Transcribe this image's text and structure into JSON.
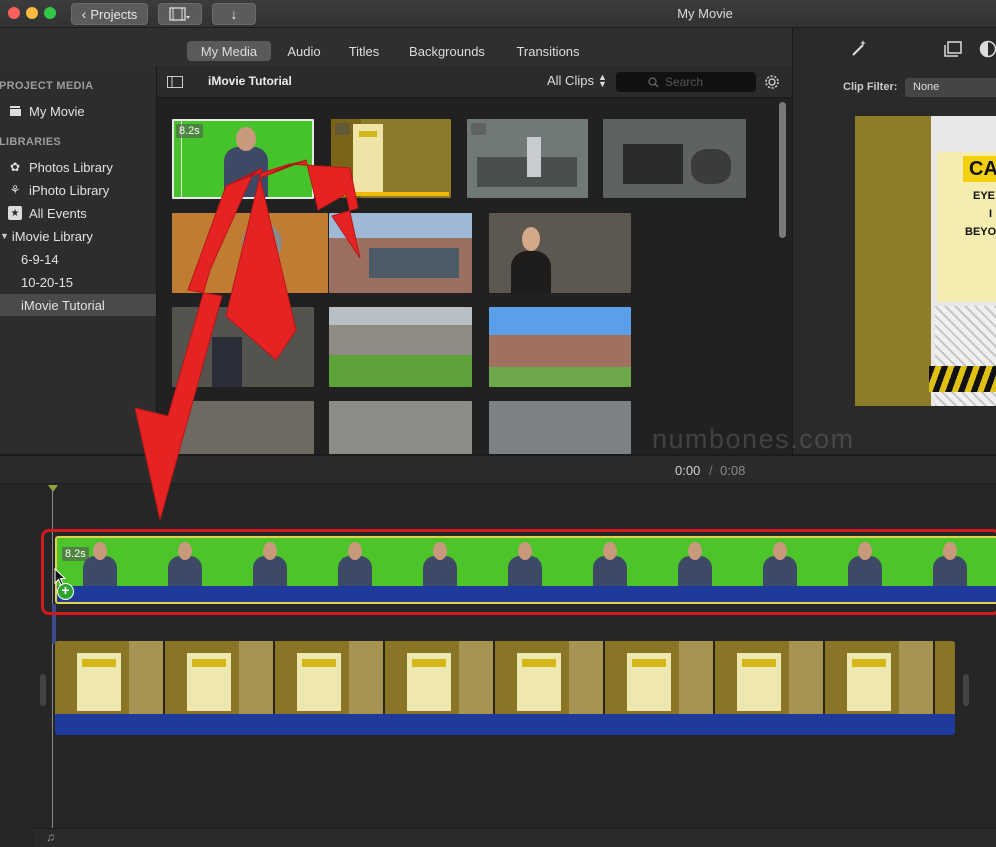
{
  "window": {
    "title": "My Movie",
    "projects_label": "Projects"
  },
  "tabs": [
    {
      "label": "My Media",
      "active": true
    },
    {
      "label": "Audio"
    },
    {
      "label": "Titles"
    },
    {
      "label": "Backgrounds"
    },
    {
      "label": "Transitions"
    }
  ],
  "sidebar": {
    "project_media_heading": "PROJECT MEDIA",
    "libraries_heading": "LIBRARIES",
    "items": [
      {
        "label": "My Movie",
        "icon": "clapperboard-icon"
      },
      {
        "label": "Photos Library",
        "icon": "photos-flower-icon"
      },
      {
        "label": "iPhoto Library",
        "icon": "palm-tree-icon"
      },
      {
        "label": "All Events",
        "icon": "star-icon"
      },
      {
        "label": "iMovie Library",
        "icon": "disclosure-triangle-icon"
      },
      {
        "label": "6-9-14"
      },
      {
        "label": "10-20-15"
      },
      {
        "label": "iMovie Tutorial",
        "selected": true
      }
    ]
  },
  "browser": {
    "title": "iMovie Tutorial",
    "filter_label": "All Clips",
    "search_placeholder": "Search",
    "first_clip_duration": "8.2s"
  },
  "viewer": {
    "clip_filter_label": "Clip Filter:",
    "clip_filter_value": "None",
    "sign_text": [
      "CA",
      "EYE",
      "I",
      "BEYO"
    ]
  },
  "timeline": {
    "current_time": "0:00",
    "separator": "/",
    "total_time": "0:08",
    "clip_duration": "8.2s",
    "add_symbol": "+"
  },
  "watermark": "numbones.com",
  "colors": {
    "accent_red": "#e52323",
    "selection_yellow": "#e0d24a",
    "green_screen": "#4cc42a",
    "audio_blue": "#1e3a9a"
  }
}
